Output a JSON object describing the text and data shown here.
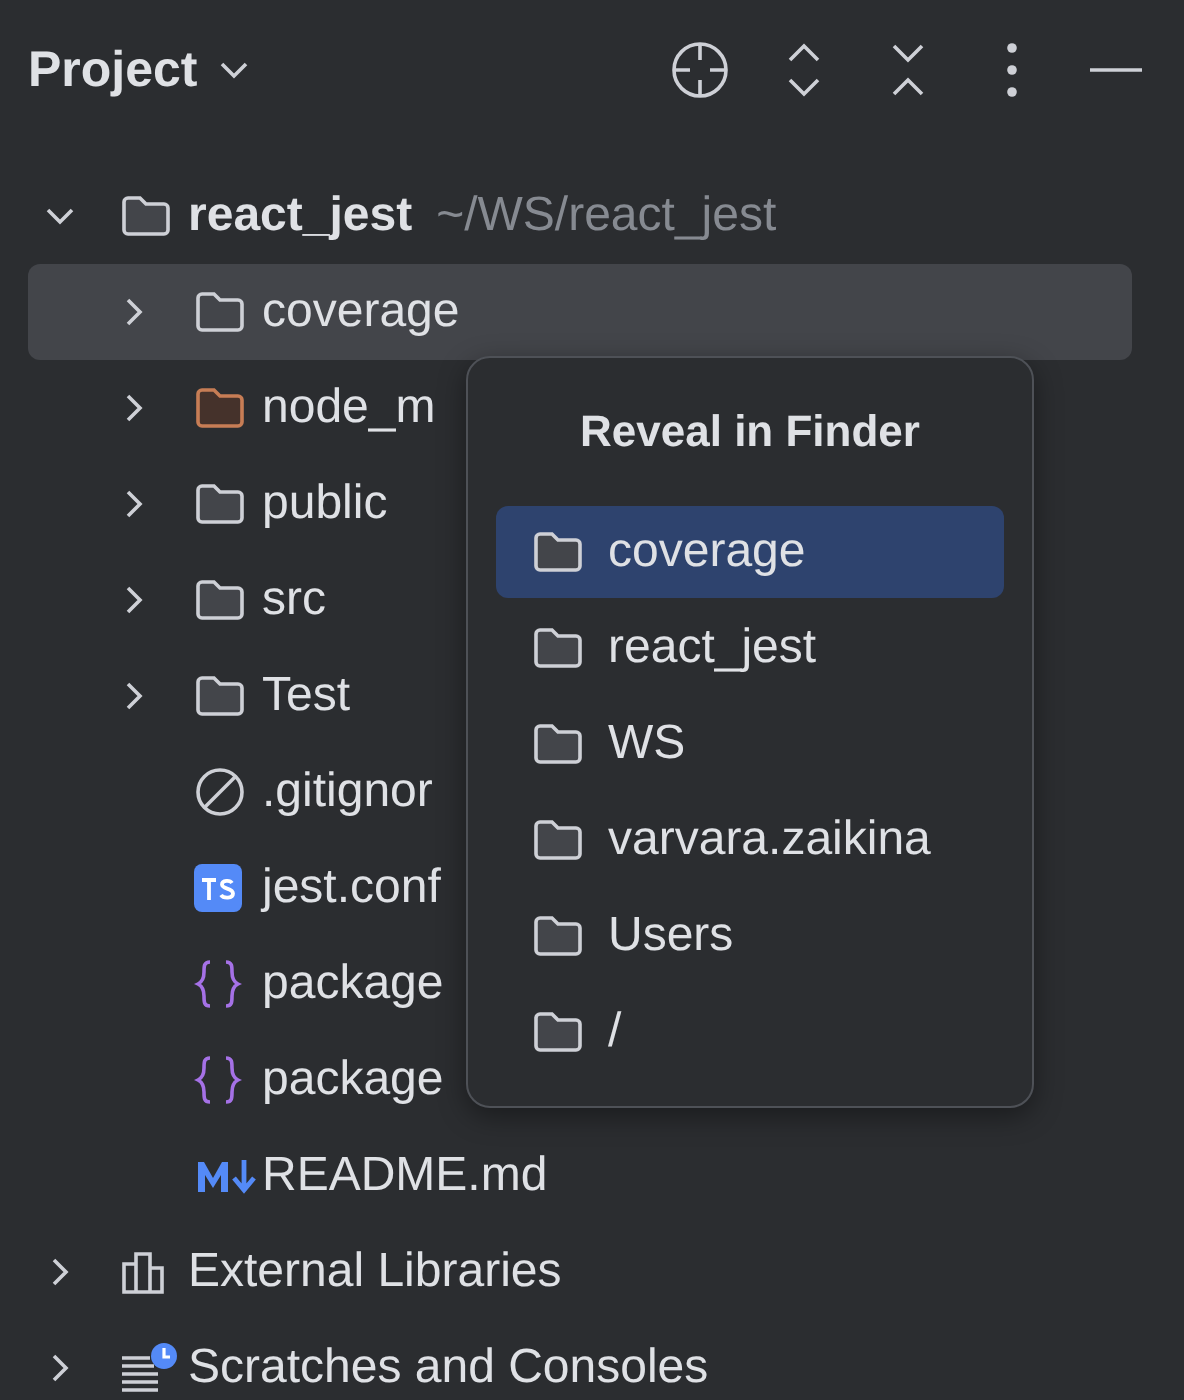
{
  "panel": {
    "title": "Project"
  },
  "tree": [
    {
      "label": "react_jest",
      "path": "~/WS/react_jest",
      "kind": "folder",
      "expanded": true,
      "selected": false,
      "children": [
        {
          "label": "coverage",
          "kind": "folder",
          "expanded": false,
          "selected": true
        },
        {
          "label": "node_m",
          "kind": "excluded-folder",
          "expanded": false,
          "selected": false
        },
        {
          "label": "public",
          "kind": "folder",
          "expanded": false,
          "selected": false
        },
        {
          "label": "src",
          "kind": "folder",
          "expanded": false,
          "selected": false
        },
        {
          "label": "Test",
          "kind": "folder",
          "expanded": false,
          "selected": false
        },
        {
          "label": ".gitignor",
          "kind": "ignore",
          "selected": false
        },
        {
          "label": "jest.conf",
          "kind": "ts",
          "selected": false
        },
        {
          "label": "package",
          "kind": "json",
          "selected": false
        },
        {
          "label": "package",
          "kind": "json",
          "selected": false
        },
        {
          "label": "README.md",
          "kind": "markdown",
          "selected": false
        }
      ]
    },
    {
      "label": "External Libraries",
      "kind": "library",
      "expanded": false,
      "selected": false
    },
    {
      "label": "Scratches and Consoles",
      "kind": "scratches",
      "expanded": false,
      "selected": false
    }
  ],
  "popup": {
    "title": "Reveal in Finder",
    "items": [
      {
        "label": "coverage",
        "selected": true
      },
      {
        "label": "react_jest",
        "selected": false
      },
      {
        "label": "WS",
        "selected": false
      },
      {
        "label": "varvara.zaikina",
        "selected": false
      },
      {
        "label": "Users",
        "selected": false
      },
      {
        "label": "/",
        "selected": false
      }
    ]
  }
}
